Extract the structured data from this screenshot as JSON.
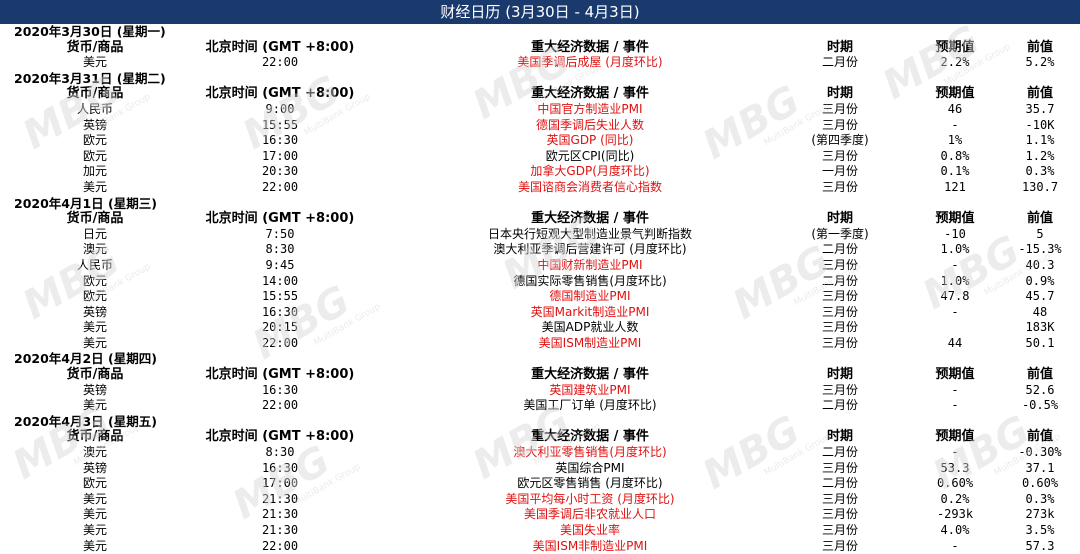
{
  "title": "财经日历 (3月30日 - 4月3日)",
  "headers": {
    "currency": "货币/商品",
    "time": "北京时间 (GMT +8:00)",
    "event": "重大经济数据 / 事件",
    "period": "时期",
    "forecast": "预期值",
    "previous": "前值"
  },
  "watermark": {
    "text": "MBG",
    "sub": "MultiBank Group"
  },
  "colors": {
    "title_bg": "#1a3a6e",
    "highlight": "#e01010"
  },
  "days": [
    {
      "date": "2020年3月30日 (星期一)",
      "rows": [
        {
          "currency": "美元",
          "time": "22:00",
          "event": "美国季调后成屋 (月度环比)",
          "period": "二月份",
          "forecast": "2.2%",
          "previous": "5.2%",
          "highlight": true
        }
      ]
    },
    {
      "date": "2020年3月31日 (星期二)",
      "rows": [
        {
          "currency": "人民币",
          "time": "9:00",
          "event": "中国官方制造业PMI",
          "period": "三月份",
          "forecast": "46",
          "previous": "35.7",
          "highlight": true
        },
        {
          "currency": "英镑",
          "time": "15:55",
          "event": "德国季调后失业人数",
          "period": "三月份",
          "forecast": "-",
          "previous": "-10K",
          "highlight": true
        },
        {
          "currency": "欧元",
          "time": "16:30",
          "event": "英国GDP (同比)",
          "period": "(第四季度)",
          "forecast": "1%",
          "previous": "1.1%",
          "highlight": true
        },
        {
          "currency": "欧元",
          "time": "17:00",
          "event": "欧元区CPI(同比)",
          "period": "三月份",
          "forecast": "0.8%",
          "previous": "1.2%",
          "highlight": false
        },
        {
          "currency": "加元",
          "time": "20:30",
          "event": "加拿大GDP(月度环比)",
          "period": "一月份",
          "forecast": "0.1%",
          "previous": "0.3%",
          "highlight": true
        },
        {
          "currency": "美元",
          "time": "22:00",
          "event": "美国谘商会消费者信心指数",
          "period": "三月份",
          "forecast": "121",
          "previous": "130.7",
          "highlight": true
        }
      ]
    },
    {
      "date": "2020年4月1日 (星期三)",
      "rows": [
        {
          "currency": "日元",
          "time": "7:50",
          "event": "日本央行短观大型制造业景气判断指数",
          "period": "(第一季度)",
          "forecast": "-10",
          "previous": "5",
          "highlight": false
        },
        {
          "currency": "澳元",
          "time": "8:30",
          "event": "澳大利亚季调后营建许可 (月度环比)",
          "period": "二月份",
          "forecast": "1.0%",
          "previous": "-15.3%",
          "highlight": false
        },
        {
          "currency": "人民币",
          "time": "9:45",
          "event": "中国财新制造业PMI",
          "period": "三月份",
          "forecast": "-",
          "previous": "40.3",
          "highlight": true
        },
        {
          "currency": "欧元",
          "time": "14:00",
          "event": "德国实际零售销售(月度环比)",
          "period": "二月份",
          "forecast": "1.0%",
          "previous": "0.9%",
          "highlight": false
        },
        {
          "currency": "欧元",
          "time": "15:55",
          "event": "德国制造业PMI",
          "period": "三月份",
          "forecast": "47.8",
          "previous": "45.7",
          "highlight": true
        },
        {
          "currency": "英镑",
          "time": "16:30",
          "event": "英国Markit制造业PMI",
          "period": "三月份",
          "forecast": "-",
          "previous": "48",
          "highlight": true
        },
        {
          "currency": "美元",
          "time": "20:15",
          "event": "美国ADP就业人数",
          "period": "三月份",
          "forecast": "",
          "previous": "183K",
          "highlight": false
        },
        {
          "currency": "美元",
          "time": "22:00",
          "event": "美国ISM制造业PMI",
          "period": "三月份",
          "forecast": "44",
          "previous": "50.1",
          "highlight": true
        }
      ]
    },
    {
      "date": "2020年4月2日 (星期四)",
      "rows": [
        {
          "currency": "英镑",
          "time": "16:30",
          "event": "英国建筑业PMI",
          "period": "三月份",
          "forecast": "-",
          "previous": "52.6",
          "highlight": true
        },
        {
          "currency": "美元",
          "time": "22:00",
          "event": "美国工厂订单 (月度环比)",
          "period": "二月份",
          "forecast": "-",
          "previous": "-0.5%",
          "highlight": false
        }
      ]
    },
    {
      "date": "2020年4月3日 (星期五)",
      "rows": [
        {
          "currency": "澳元",
          "time": "8:30",
          "event": "澳大利亚零售销售(月度环比)",
          "period": "二月份",
          "forecast": "-",
          "previous": "-0.30%",
          "highlight": true
        },
        {
          "currency": "英镑",
          "time": "16:30",
          "event": "英国综合PMI",
          "period": "三月份",
          "forecast": "53.3",
          "previous": "37.1",
          "highlight": false
        },
        {
          "currency": "欧元",
          "time": "17:00",
          "event": "欧元区零售销售 (月度环比)",
          "period": "二月份",
          "forecast": "0.60%",
          "previous": "0.60%",
          "highlight": false
        },
        {
          "currency": "美元",
          "time": "21:30",
          "event": "美国平均每小时工资 (月度环比)",
          "period": "三月份",
          "forecast": "0.2%",
          "previous": "0.3%",
          "highlight": true
        },
        {
          "currency": "美元",
          "time": "21:30",
          "event": "美国季调后非农就业人口",
          "period": "三月份",
          "forecast": "-293k",
          "previous": "273k",
          "highlight": true
        },
        {
          "currency": "美元",
          "time": "21:30",
          "event": "美国失业率",
          "period": "三月份",
          "forecast": "4.0%",
          "previous": "3.5%",
          "highlight": true
        },
        {
          "currency": "美元",
          "time": "22:00",
          "event": "美国ISM非制造业PMI",
          "period": "三月份",
          "forecast": "-",
          "previous": "57.3",
          "highlight": true
        }
      ]
    }
  ]
}
